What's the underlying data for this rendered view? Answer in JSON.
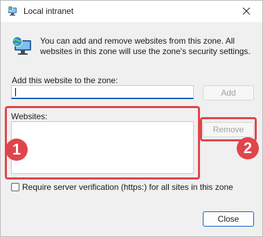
{
  "window": {
    "title": "Local intranet"
  },
  "info": {
    "text": "You can add and remove websites from this zone. All websites in this zone will use the zone's security settings."
  },
  "add_section": {
    "label": "Add this website to the zone:",
    "input_value": "",
    "add_button": "Add"
  },
  "websites_section": {
    "label": "Websites:",
    "items": [],
    "remove_button": "Remove"
  },
  "checkbox": {
    "label": "Require server verification (https:) for all sites in this zone",
    "checked": false
  },
  "close_button": "Close",
  "annotations": {
    "badge_1": "1",
    "badge_2": "2",
    "highlight_color": "#e0454b"
  },
  "icons": {
    "app": "globe-monitor-icon",
    "info": "globe-monitor-icon",
    "close": "close-icon"
  },
  "colors": {
    "accent": "#0f5fbf",
    "disabled_text": "#a0a0a0"
  }
}
